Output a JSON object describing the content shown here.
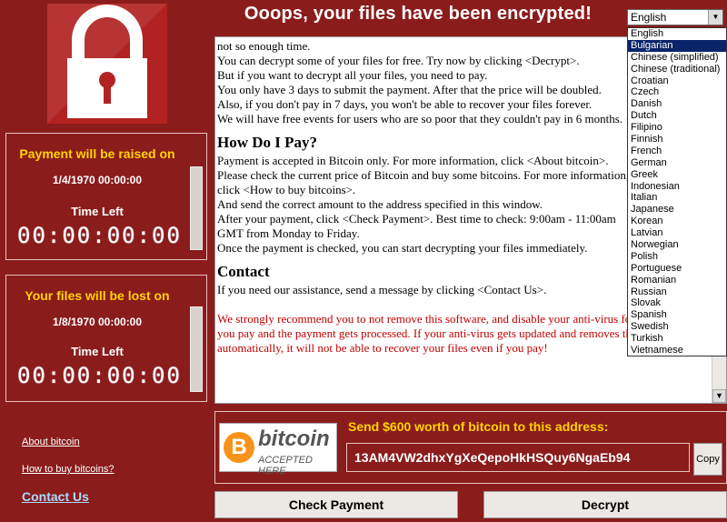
{
  "title": "Ooops, your files have been encrypted!",
  "panels": {
    "raise": {
      "heading": "Payment will be raised on",
      "date": "1/4/1970 00:00:00",
      "time_left_label": "Time Left",
      "timer": "00:00:00:00"
    },
    "lost": {
      "heading": "Your files will be lost on",
      "date": "1/8/1970 00:00:00",
      "time_left_label": "Time Left",
      "timer": "00:00:00:00"
    }
  },
  "message": {
    "lines_top": [
      "not so enough time.",
      "You can decrypt some of your files for free. Try now by clicking <Decrypt>.",
      "But if you want to decrypt all your files, you need to pay.",
      "You only have 3 days to submit the payment. After that the price will be doubled.",
      "Also, if you don't pay in 7 days, you won't be able to recover your files forever.",
      "We will have free events for users who are so poor that they couldn't pay in 6 months."
    ],
    "how_heading": "How Do I Pay?",
    "lines_how": [
      "Payment is accepted in Bitcoin only. For more information, click <About bitcoin>.",
      "Please check the current price of Bitcoin and buy some bitcoins. For more information,",
      "click <How to buy bitcoins>.",
      "And send the correct amount to the address specified in this window.",
      "After your payment, click <Check Payment>. Best time to check: 9:00am - 11:00am",
      "GMT from Monday to Friday.",
      "Once the payment is checked, you can start decrypting your files immediately."
    ],
    "contact_heading": "Contact",
    "contact_line": "If you need our assistance, send a message by clicking <Contact Us>.",
    "warning": "We strongly recommend you to not remove this software, and disable your anti-virus for a while, until you pay and the payment gets processed. If your anti-virus gets updated and removes this software automatically, it will not be able to recover your files even if you pay!"
  },
  "language": {
    "selected": "English",
    "options": [
      "English",
      "Bulgarian",
      "Chinese (simplified)",
      "Chinese (traditional)",
      "Croatian",
      "Czech",
      "Danish",
      "Dutch",
      "Filipino",
      "Finnish",
      "French",
      "German",
      "Greek",
      "Indonesian",
      "Italian",
      "Japanese",
      "Korean",
      "Latvian",
      "Norwegian",
      "Polish",
      "Portuguese",
      "Romanian",
      "Russian",
      "Slovak",
      "Spanish",
      "Swedish",
      "Turkish",
      "Vietnamese"
    ],
    "highlighted_index": 1
  },
  "bitcoin": {
    "logo_word": "bitcoin",
    "logo_accepted": "ACCEPTED HERE",
    "logo_symbol": "B",
    "send_label": "Send $600 worth of bitcoin to this address:",
    "address": "13AM4VW2dhxYgXeQepoHkHSQuy6NgaEb94",
    "copy_label": "Copy"
  },
  "links": {
    "about": "About bitcoin",
    "how_to_buy": "How to buy bitcoins?",
    "contact": "Contact Us"
  },
  "buttons": {
    "check_payment": "Check Payment",
    "decrypt": "Decrypt"
  },
  "colors": {
    "background": "#8b1c1c",
    "accent_yellow": "#ffd400",
    "warning_red": "#c00000",
    "link_blue": "#a8dcff"
  }
}
